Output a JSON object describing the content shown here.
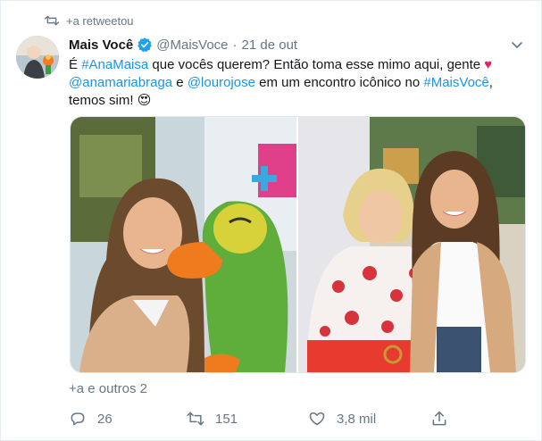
{
  "retweet": {
    "label": "+a retweetou",
    "icon": "retweet-icon"
  },
  "tweet": {
    "author_name": "Mais Você",
    "handle": "@MaisVoce",
    "separator": "·",
    "date": "21 de out",
    "verified_icon": "verified-badge-icon",
    "text_parts": {
      "p1": "É ",
      "tag1": "#AnaMaisa",
      "p2": " que vocês querem? Então toma esse mimo aqui, gente ",
      "heart": "♥",
      "mention1": "@anamariabraga",
      "p3": " e ",
      "mention2": "@lourojose",
      "p4": " em um encontro icônico no ",
      "tag2": "#MaisVocê",
      "p5": ",",
      "p6": "temos sim! ",
      "emoji": "😍"
    },
    "tagged": "+a e outros 2"
  },
  "actions": {
    "reply": {
      "count": "26",
      "icon": "reply-icon"
    },
    "retweet": {
      "count": "151",
      "icon": "retweet-icon"
    },
    "like": {
      "count": "3,8 mil",
      "icon": "heart-icon"
    },
    "share": {
      "icon": "share-icon"
    }
  },
  "colors": {
    "accent": "#1da1f2",
    "link": "#1b95e0",
    "muted": "#657786",
    "heart": "#e0245e"
  }
}
